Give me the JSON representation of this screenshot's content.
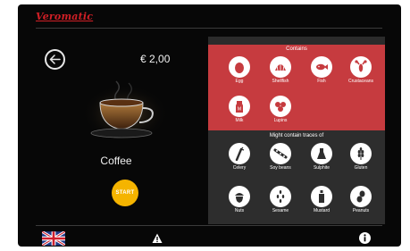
{
  "brand": {
    "logo_text": "Veromatic"
  },
  "product": {
    "price": "€ 2,00",
    "name": "Coffee",
    "start_label": "START"
  },
  "allergens": {
    "contains_title": "Contains",
    "contains": [
      {
        "label": "Egg",
        "icon": "egg-icon"
      },
      {
        "label": "Shellfish",
        "icon": "shellfish-icon"
      },
      {
        "label": "Fish",
        "icon": "fish-icon"
      },
      {
        "label": "Crustaceans",
        "icon": "crustaceans-icon"
      },
      {
        "label": "Milk",
        "icon": "milk-icon"
      },
      {
        "label": "Lupins",
        "icon": "lupins-icon"
      }
    ],
    "traces_title": "Might contain traces of",
    "traces": [
      {
        "label": "Celery",
        "icon": "celery-icon"
      },
      {
        "label": "Soy beans",
        "icon": "soy-beans-icon"
      },
      {
        "label": "Sulphite",
        "icon": "sulphite-icon"
      },
      {
        "label": "Gluten",
        "icon": "gluten-icon"
      },
      {
        "label": "Nuts",
        "icon": "nuts-icon"
      },
      {
        "label": "Sesame",
        "icon": "sesame-icon"
      },
      {
        "label": "Mustard",
        "icon": "mustard-icon"
      },
      {
        "label": "Peanuts",
        "icon": "peanuts-icon"
      }
    ]
  },
  "footer": {
    "language_icon": "uk-flag-icon",
    "warning_icon": "warning-icon",
    "info_icon": "info-icon"
  },
  "colors": {
    "contains_bg": "#c63b3f",
    "start_button": "#f5b400",
    "logo": "#d21f26"
  }
}
